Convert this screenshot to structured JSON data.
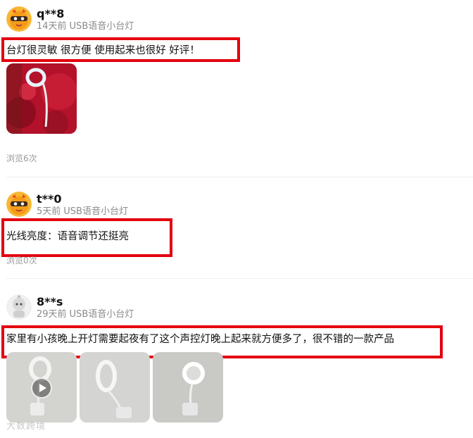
{
  "reviews": [
    {
      "username": "q**8",
      "time": "14天前",
      "product": "USB语音小台灯",
      "content": "台灯很灵敏 很方便 使用起来也很好 好评！",
      "views": "浏览6次",
      "avatar_icon": "orange-masked-mascot-avatar-icon"
    },
    {
      "username": "t**0",
      "time": "5天前",
      "product": "USB语音小台灯",
      "content": "光线亮度：语音调节还挺亮",
      "views": "浏览0次",
      "avatar_icon": "orange-masked-mascot-avatar-icon"
    },
    {
      "username": "8**s",
      "time": "29天前",
      "product": "USB语音小台灯",
      "content": "家里有小孩晚上开灯需要起夜有了这个声控灯晚上起来就方便多了，很不错的一款产品",
      "avatar_icon": "gray-robot-avatar-icon"
    }
  ],
  "watermark": "大数跨境",
  "colors": {
    "highlight": "#e3000f",
    "meta": "#8a8a8a",
    "accent_avatar": "#f5a623"
  }
}
